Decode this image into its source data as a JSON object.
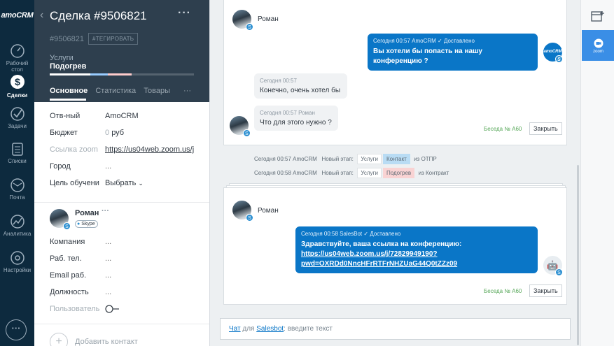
{
  "nav": {
    "logo": "amoCRM",
    "items": [
      {
        "label": "Рабочий стол",
        "icon": "dashboard-icon"
      },
      {
        "label": "Сделки",
        "icon": "deals-icon"
      },
      {
        "label": "Задачи",
        "icon": "tasks-icon"
      },
      {
        "label": "Списки",
        "icon": "lists-icon"
      },
      {
        "label": "Почта",
        "icon": "mail-icon"
      },
      {
        "label": "Аналитика",
        "icon": "analytics-icon"
      },
      {
        "label": "Настройки",
        "icon": "settings-icon"
      }
    ]
  },
  "deal": {
    "title": "Сделка #9506821",
    "number": "#9506821",
    "tag_button": "#ТЕГИРОВАТЬ",
    "pipeline": "Услуги",
    "stage": "Подогрев",
    "stage_colors": [
      "#ffffff",
      "#99ccff",
      "#ffcccc",
      "#d9d9d9"
    ],
    "tabs": [
      "Основное",
      "Статистика",
      "Товары"
    ],
    "tabs_more": "···",
    "fields": [
      {
        "label": "Отв-ный",
        "value": "AmoCRM"
      },
      {
        "label": "Бюджет",
        "value": "0",
        "unit": "руб"
      },
      {
        "label": "Ссылка zoom",
        "value": "https://us04web.zoom.us/j"
      },
      {
        "label": "Город",
        "value": "..."
      },
      {
        "label": "Цель обучени",
        "value": "Выбрать"
      }
    ]
  },
  "contact": {
    "name": "Роман",
    "channel": "Skype",
    "more": "···",
    "fields": [
      {
        "label": "Компания",
        "value": "..."
      },
      {
        "label": "Раб. тел.",
        "value": "..."
      },
      {
        "label": "Email раб.",
        "value": "..."
      },
      {
        "label": "Должность",
        "value": "..."
      },
      {
        "label": "Пользователь",
        "value": ""
      }
    ],
    "add_contact": "Добавить контакт"
  },
  "chat": {
    "top": {
      "username": "Роман",
      "out_meta": "Сегодня 00:57 AmoCRM",
      "out_status": "Доставлено",
      "out_text": "Вы хотели бы попасть на нашу конференцию ?",
      "in1_meta": "Сегодня 00:57",
      "in1_text": "Конечно, очень хотел бы",
      "in2_meta": "Сегодня 00:57 Роман",
      "in2_text": "Что для этого нужно ?",
      "conversation": "Беседа № А60",
      "close": "Закрыть"
    },
    "events": [
      {
        "time": "Сегодня 00:57 AmoCRM",
        "label": "Новый этап:",
        "pipeline": "Услуги",
        "stage": "Контакт",
        "from": "из ОТПР"
      },
      {
        "time": "Сегодня 00:58 AmoCRM",
        "label": "Новый этап:",
        "pipeline": "Услуги",
        "stage": "Подогрев",
        "from": "из Контракт"
      }
    ],
    "bottom": {
      "username": "Роман",
      "out_meta": "Сегодня 00:58 SalesBot",
      "out_status": "Доставлено",
      "out_text": "Здравствуйте, ваша ссылка на конференцию:",
      "link_line1": "https://us04web.zoom.us/j/72829949190?",
      "link_line2": "pwd=OXRDd0NncHFrRTFrNHZUaG44Q0tZZz09",
      "conversation": "Беседа № А60",
      "close": "Закрыть"
    },
    "input": {
      "chat": "Чат",
      "for": "для",
      "bot": "Salesbot",
      "placeholder": ": введите текст"
    }
  },
  "right": {
    "zoom_label": "zoom"
  }
}
